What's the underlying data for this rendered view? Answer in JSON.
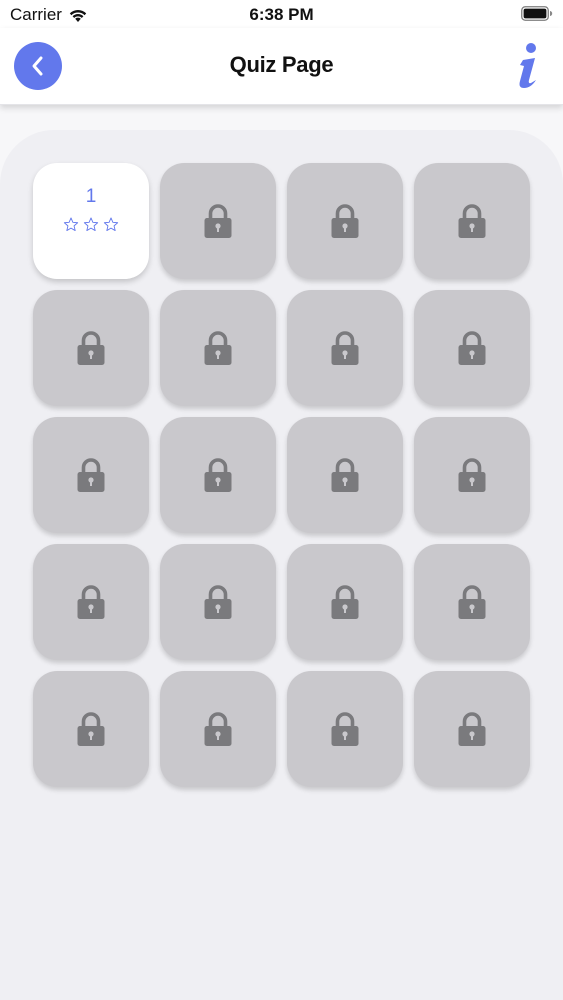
{
  "status_bar": {
    "carrier": "Carrier",
    "time": "6:38 PM"
  },
  "nav": {
    "title": "Quiz Page",
    "back_icon": "chevron-left-icon",
    "info_icon": "info-icon"
  },
  "colors": {
    "accent": "#6278ec",
    "locked_tile": "#c9c8cc",
    "lock_icon": "#7a7a7d",
    "panel": "#efeff3"
  },
  "levels": [
    {
      "number": "1",
      "locked": false,
      "stars_earned": 0,
      "stars_total": 3
    },
    {
      "locked": true
    },
    {
      "locked": true
    },
    {
      "locked": true
    },
    {
      "locked": true
    },
    {
      "locked": true
    },
    {
      "locked": true
    },
    {
      "locked": true
    },
    {
      "locked": true
    },
    {
      "locked": true
    },
    {
      "locked": true
    },
    {
      "locked": true
    },
    {
      "locked": true
    },
    {
      "locked": true
    },
    {
      "locked": true
    },
    {
      "locked": true
    },
    {
      "locked": true
    },
    {
      "locked": true
    },
    {
      "locked": true
    },
    {
      "locked": true
    }
  ]
}
